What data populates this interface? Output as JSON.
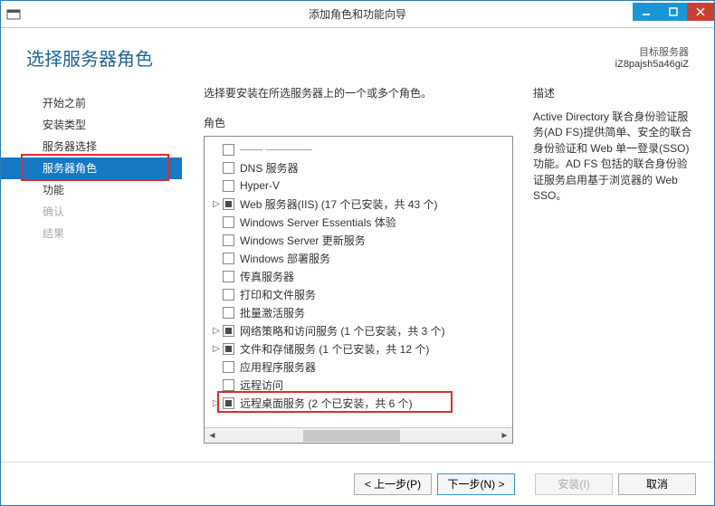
{
  "window": {
    "title": "添加角色和功能向导"
  },
  "header": {
    "page_title": "选择服务器角色",
    "dest_label": "目标服务器",
    "dest_value": "iZ8pajsh5a46giZ"
  },
  "sidebar": {
    "items": [
      {
        "label": "开始之前",
        "state": "normal"
      },
      {
        "label": "安装类型",
        "state": "normal"
      },
      {
        "label": "服务器选择",
        "state": "normal"
      },
      {
        "label": "服务器角色",
        "state": "selected"
      },
      {
        "label": "功能",
        "state": "normal"
      },
      {
        "label": "确认",
        "state": "disabled"
      },
      {
        "label": "结果",
        "state": "disabled"
      }
    ]
  },
  "main": {
    "instruction": "选择要安装在所选服务器上的一个或多个角色。",
    "roles_label": "角色",
    "roles": [
      {
        "label": "DNS 服务器",
        "check": "unchecked",
        "expandable": false
      },
      {
        "label": "Hyper-V",
        "check": "unchecked",
        "expandable": false
      },
      {
        "label": "Web 服务器(IIS) (17 个已安装，共 43 个)",
        "check": "partial",
        "expandable": true
      },
      {
        "label": "Windows Server Essentials 体验",
        "check": "unchecked",
        "expandable": false
      },
      {
        "label": "Windows Server 更新服务",
        "check": "unchecked",
        "expandable": false
      },
      {
        "label": "Windows 部署服务",
        "check": "unchecked",
        "expandable": false
      },
      {
        "label": "传真服务器",
        "check": "unchecked",
        "expandable": false
      },
      {
        "label": "打印和文件服务",
        "check": "unchecked",
        "expandable": false
      },
      {
        "label": "批量激活服务",
        "check": "unchecked",
        "expandable": false
      },
      {
        "label": "网络策略和访问服务 (1 个已安装，共 3 个)",
        "check": "partial",
        "expandable": true
      },
      {
        "label": "文件和存储服务 (1 个已安装，共 12 个)",
        "check": "partial",
        "expandable": true
      },
      {
        "label": "应用程序服务器",
        "check": "unchecked",
        "expandable": false
      },
      {
        "label": "远程访问",
        "check": "unchecked",
        "expandable": false
      },
      {
        "label": "远程桌面服务 (2 个已安装，共 6 个)",
        "check": "partial",
        "expandable": true,
        "highlight": true
      }
    ]
  },
  "right": {
    "desc_label": "描述",
    "desc_text": "Active Directory 联合身份验证服务(AD FS)提供简单、安全的联合身份验证和 Web 单一登录(SSO)功能。AD FS 包括的联合身份验证服务启用基于浏览器的 Web SSO。"
  },
  "footer": {
    "prev": "< 上一步(P)",
    "next": "下一步(N) >",
    "install": "安装(I)",
    "cancel": "取消"
  }
}
